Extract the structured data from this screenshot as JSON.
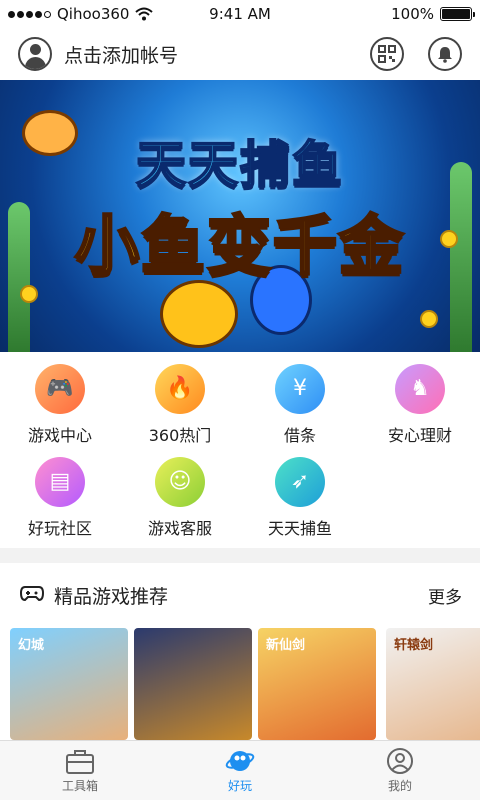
{
  "status_bar": {
    "carrier": "Qihoo360",
    "time": "9:41 AM",
    "battery": "100%",
    "battery_level": 1.0
  },
  "header": {
    "account_label": "点击添加帐号",
    "avatar_icon": "user-avatar-icon",
    "qr_icon": "qr-code-icon",
    "bell_icon": "bell-icon"
  },
  "banner": {
    "title": "天天捕鱼",
    "slogan": "小鱼变千金"
  },
  "shortcuts": [
    {
      "label": "游戏中心",
      "icon": "gamepad-icon",
      "color_from": "#ffb36b",
      "color_to": "#ff6a3d",
      "glyph": "🎮"
    },
    {
      "label": "360热门",
      "icon": "fire-icon",
      "color_from": "#ffd75a",
      "color_to": "#ff8a1f",
      "glyph": "🔥"
    },
    {
      "label": "借条",
      "icon": "yen-icon",
      "color_from": "#6fd2ff",
      "color_to": "#2f8ff5",
      "glyph": "¥"
    },
    {
      "label": "安心理财",
      "icon": "horse-icon",
      "color_from": "#c89bff",
      "color_to": "#ff6fb5",
      "glyph": "♞"
    },
    {
      "label": "好玩社区",
      "icon": "newspaper-icon",
      "color_from": "#ff8fd0",
      "color_to": "#b45bff",
      "glyph": "▤"
    },
    {
      "label": "游戏客服",
      "icon": "headset-icon",
      "color_from": "#e8ef5a",
      "color_to": "#8ccf35",
      "glyph": "☺"
    },
    {
      "label": "天天捕鱼",
      "icon": "rocket-icon",
      "color_from": "#4de0c8",
      "color_to": "#1e9fd8",
      "glyph": "➶"
    }
  ],
  "recommendations": {
    "title": "精品游戏推荐",
    "more_label": "更多",
    "icon": "gamepad-outline-icon",
    "games": [
      {
        "title": "幻城",
        "color_from": "#7fd0ff",
        "color_to": "#e8b07a"
      },
      {
        "title": "",
        "color_from": "#2b3a6e",
        "color_to": "#c8892a"
      },
      {
        "title": "新仙剑",
        "color_from": "#f6d365",
        "color_to": "#e36b2f"
      },
      {
        "title": "轩辕剑",
        "color_from": "#f1f1f1",
        "color_to": "#e6b58a"
      }
    ]
  },
  "tab_bar": {
    "tabs": [
      {
        "label": "工具箱",
        "icon": "toolbox-icon",
        "active": false
      },
      {
        "label": "好玩",
        "icon": "planet-icon",
        "active": true
      },
      {
        "label": "我的",
        "icon": "profile-icon",
        "active": false
      }
    ]
  }
}
